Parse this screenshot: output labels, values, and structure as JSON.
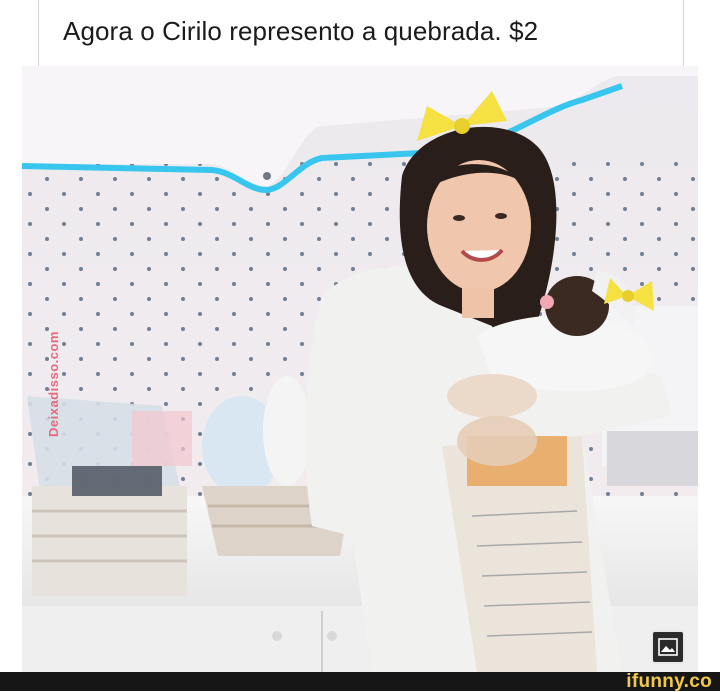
{
  "post": {
    "caption": "Agora o Cirilo represento a quebrada. $2"
  },
  "photo": {
    "watermark": "Deixadisso.com",
    "scene": {
      "wall_color": "#efe9ec",
      "dot_color": "#5a6c84",
      "trim_color": "#38c6ef",
      "bow_color": "#f5e142",
      "coat_color": "#f1f1f0"
    }
  },
  "controls": {
    "image_icon": "image-icon"
  },
  "footer": {
    "brand": "ifunny.co",
    "brand_color": "#f2c94c"
  }
}
